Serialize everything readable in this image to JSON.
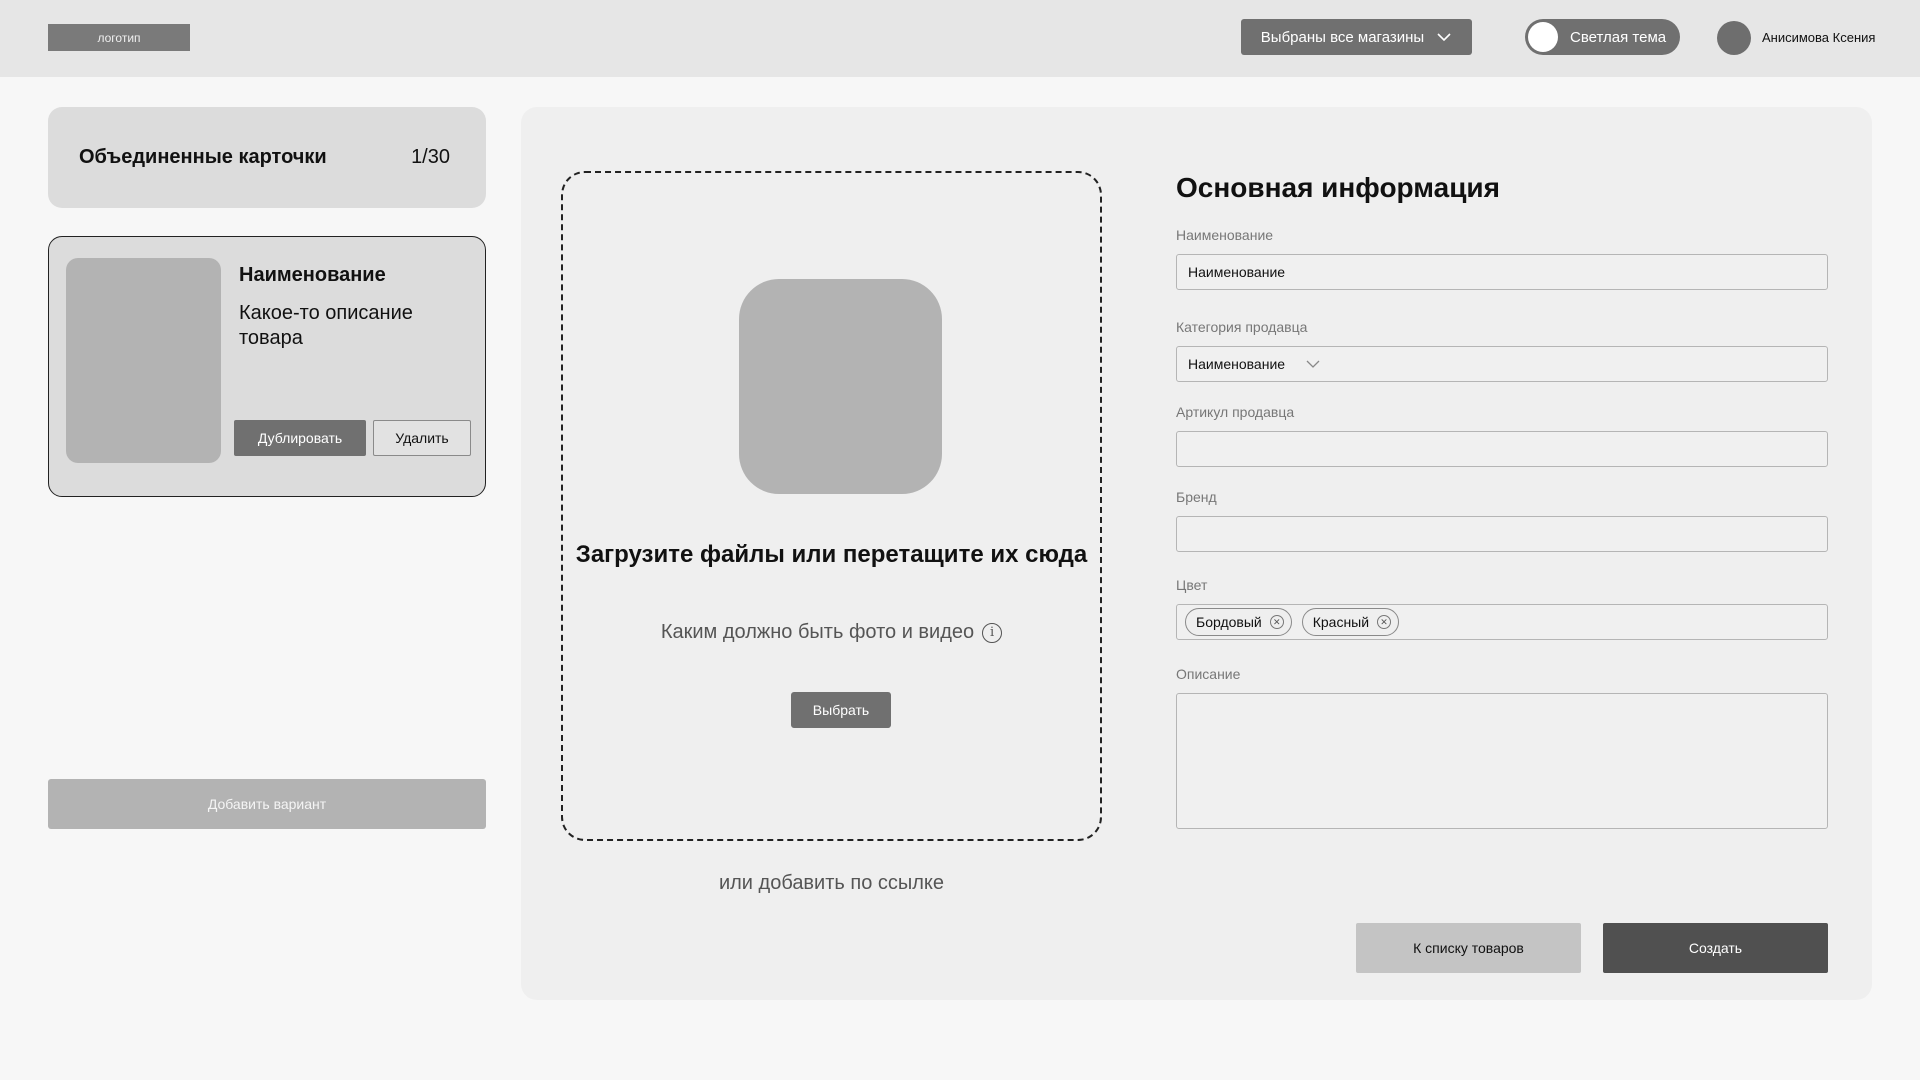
{
  "header": {
    "logo_text": "логотип",
    "store_selector": "Выбраны все магазины",
    "theme_toggle": "Светлая тема",
    "user_name": "Анисимова Ксения"
  },
  "sidebar": {
    "summary_title": "Объединенные карточки",
    "summary_count": "1/30",
    "variant": {
      "name": "Наименование",
      "description": "Какое-то описание товара",
      "duplicate_label": "Дублировать",
      "delete_label": "Удалить"
    },
    "add_variant_label": "Добавить вариант"
  },
  "upload": {
    "title": "Загрузите файлы или перетащите их сюда",
    "hint": "Каким должно быть фото и видео",
    "choose_label": "Выбрать",
    "by_link": "или добавить по ссылке"
  },
  "form": {
    "title": "Основная информация",
    "fields": {
      "name": {
        "label": "Наименование",
        "value": "Наименование"
      },
      "category": {
        "label": "Категория продавца",
        "value": "Наименование"
      },
      "article": {
        "label": "Артикул продавца",
        "value": ""
      },
      "brand": {
        "label": "Бренд",
        "value": ""
      },
      "color": {
        "label": "Цвет",
        "chips": [
          "Бордовый",
          "Красный"
        ]
      },
      "description": {
        "label": "Описание",
        "value": ""
      }
    },
    "back_label": "К списку товаров",
    "create_label": "Создать"
  },
  "icons": {
    "store_chevron": "chevron-down-icon",
    "category_chevron": "chevron-down-icon",
    "info": "info-icon",
    "chip_remove": "close-circle-icon"
  },
  "colors": {
    "topbar_bg": "#e6e6e6",
    "panel_bg": "#efefef",
    "dark_button": "#707070",
    "create_button": "#505050"
  }
}
